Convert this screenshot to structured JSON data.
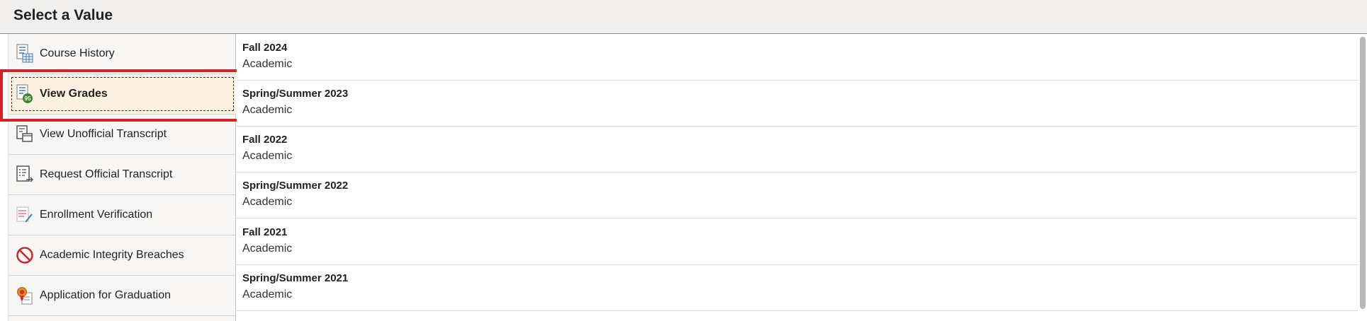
{
  "header": {
    "title": "Select a Value"
  },
  "sidebar": {
    "items": [
      {
        "label": "Course History",
        "icon": "course-history-icon"
      },
      {
        "label": "View Grades",
        "icon": "view-grades-icon",
        "selected": true
      },
      {
        "label": "View Unofficial Transcript",
        "icon": "unofficial-transcript-icon"
      },
      {
        "label": "Request Official Transcript",
        "icon": "request-transcript-icon"
      },
      {
        "label": "Enrollment Verification",
        "icon": "enrollment-verification-icon"
      },
      {
        "label": "Academic Integrity Breaches",
        "icon": "prohibited-icon"
      },
      {
        "label": "Application for Graduation",
        "icon": "graduation-ribbon-icon"
      }
    ],
    "grades_badge": "95"
  },
  "terms": [
    {
      "term": "Fall 2024",
      "career": "Academic"
    },
    {
      "term": "Spring/Summer 2023",
      "career": "Academic"
    },
    {
      "term": "Fall 2022",
      "career": "Academic"
    },
    {
      "term": "Spring/Summer 2022",
      "career": "Academic"
    },
    {
      "term": "Fall 2021",
      "career": "Academic"
    },
    {
      "term": "Spring/Summer 2021",
      "career": "Academic"
    }
  ],
  "colors": {
    "selected_bg": "#fdf2e1",
    "highlight_border": "#d3222a",
    "grades_badge": "#3b8a2a",
    "prohibited": "#c8282d"
  }
}
